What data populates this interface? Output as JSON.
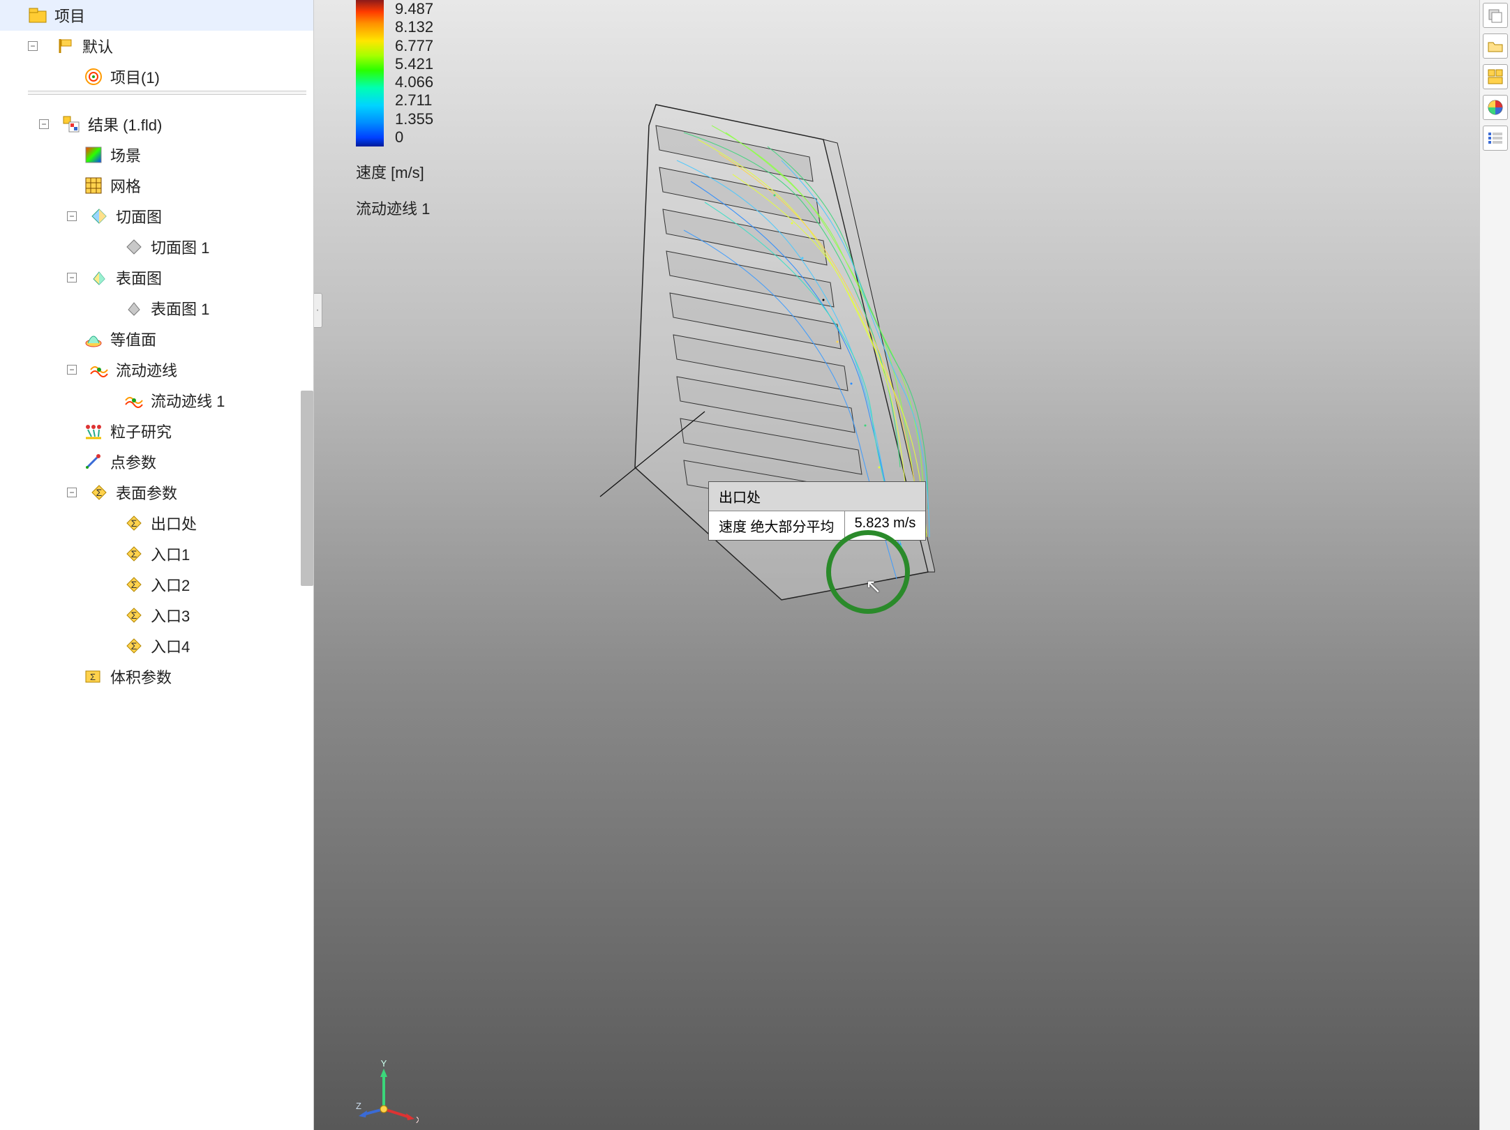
{
  "tree": {
    "project": "项目",
    "default": "默认",
    "project1": "项目(1)",
    "results": "结果 (1.fld)",
    "scene": "场景",
    "mesh": "网格",
    "cutplot": "切面图",
    "cutplot1": "切面图 1",
    "surfaceplot": "表面图",
    "surfaceplot1": "表面图 1",
    "isosurface": "等值面",
    "flowtraj": "流动迹线",
    "flowtraj1": "流动迹线 1",
    "particle": "粒子研究",
    "pointparam": "点参数",
    "surfaceparam": "表面参数",
    "sp_outlet": "出口处",
    "sp_in1": "入口1",
    "sp_in2": "入口2",
    "sp_in3": "入口3",
    "sp_in4": "入口4",
    "volparam": "体积参数"
  },
  "legend": {
    "ticks": [
      "9.487",
      "8.132",
      "6.777",
      "5.421",
      "4.066",
      "2.711",
      "1.355",
      "0"
    ],
    "label": "速度 [m/s]",
    "sub": "流动迹线 1"
  },
  "callout": {
    "title": "出口处",
    "param": "速度 绝大部分平均",
    "value": "5.823 m/s"
  },
  "triad": {
    "x": "X",
    "y": "Y",
    "z": "Z"
  },
  "chart_data": {
    "type": "legend",
    "title": "速度 [m/s]",
    "series_name": "流动迹线 1",
    "range": [
      0,
      9.487
    ],
    "ticks": [
      9.487,
      8.132,
      6.777,
      5.421,
      4.066,
      2.711,
      1.355,
      0
    ],
    "callout": {
      "location": "出口处",
      "parameter": "速度 绝大部分平均",
      "value": 5.823,
      "unit": "m/s"
    }
  }
}
